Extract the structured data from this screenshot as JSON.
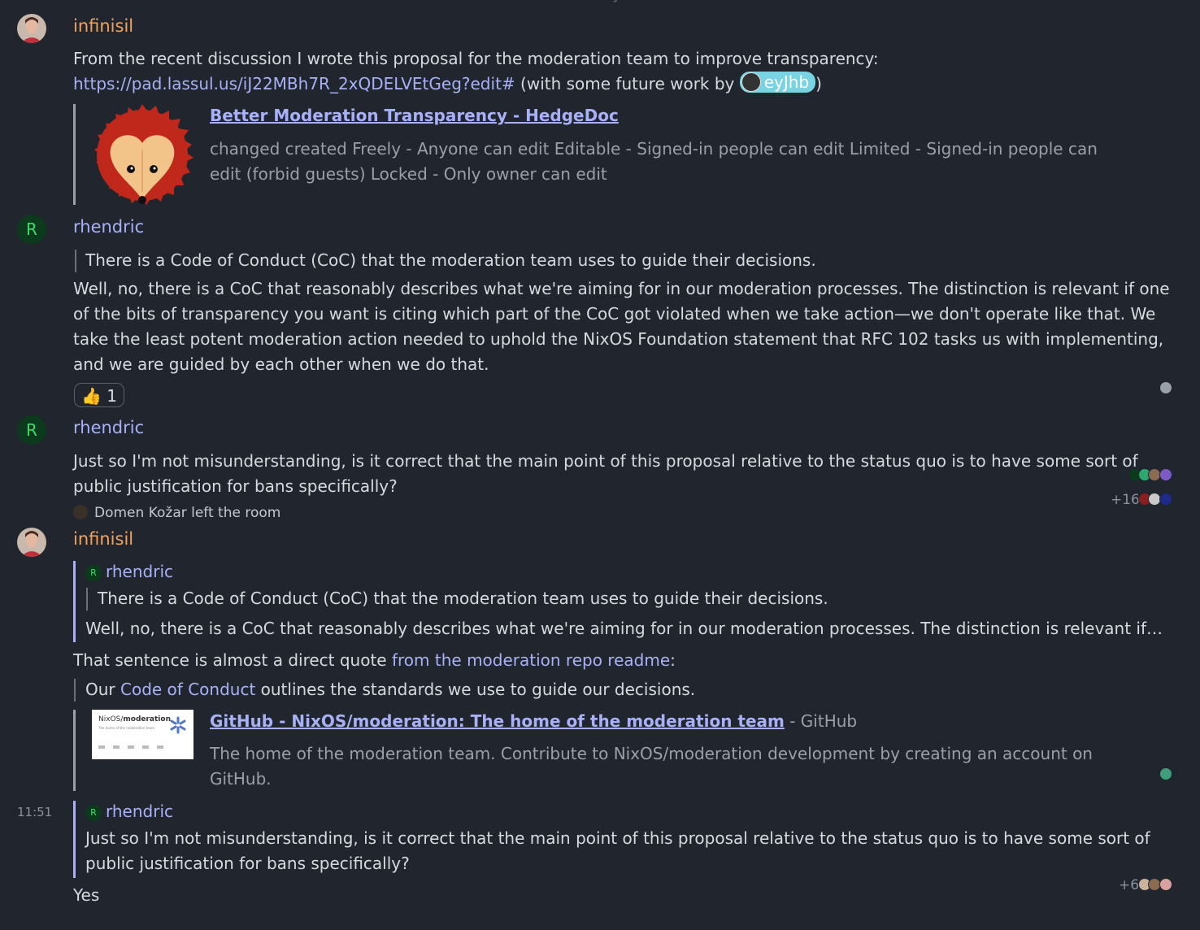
{
  "date_separator": "Today",
  "messages": [
    {
      "sender": "infinisil",
      "line1": "From the recent discussion I wrote this proposal for the moderation team to improve transparency:",
      "link": "https://pad.lassul.us/iJ22MBh7R_2xQDELVEtGeg?edit#",
      "after_link": " (with some future work by ",
      "mention": "eyJhb",
      "after_mention": ")",
      "preview": {
        "title": "Better Moderation Transparency - HedgeDoc",
        "desc_line1": "changed created Freely - Anyone can edit Editable - Signed-in people can edit Limited - Signed-in people can",
        "desc_line2": "edit (forbid guests) Locked - Only owner can edit"
      }
    },
    {
      "sender": "rhendric",
      "avatar_letter": "R",
      "quote": "There is a Code of Conduct (CoC) that the moderation team uses to guide their decisions.",
      "lines": [
        "Well, no, there is a CoC that reasonably describes what we're aiming for in our moderation processes. The distinction is relevant if one",
        "of the bits of transparency you want is citing which part of the CoC got violated when we take action—we don't operate like that. We",
        "take the least potent moderation action needed to uphold the NixOS Foundation statement that RFC 102 tasks us with implementing,",
        "and we are guided by each other when we do that."
      ],
      "reaction": {
        "emoji": "👍",
        "count": "1"
      }
    },
    {
      "sender": "rhendric",
      "avatar_letter": "R",
      "lines": [
        "Just so I'm not misunderstanding, is it correct that the main point of this proposal relative to the status quo is to have some sort of",
        "public justification for bans specifically?"
      ],
      "receipts_extra": "+16"
    },
    {
      "event": "Domen Kožar left the room"
    },
    {
      "sender": "infinisil",
      "reply": {
        "sender": "rhendric",
        "avatar_letter": "R",
        "quote": "There is a Code of Conduct (CoC) that the moderation team uses to guide their decisions.",
        "text": "Well, no, there is a CoC that reasonably describes what we're aiming for in our moderation processes. The distinction is relevant if…"
      },
      "line_pre": "That sentence is almost a direct quote ",
      "line_link": "from the moderation repo readme",
      "line_post": ":",
      "quote_pre": "Our ",
      "quote_link": "Code of Conduct",
      "quote_post": " outlines the standards we use to guide our decisions.",
      "preview": {
        "thumb_title_a": "NixOS/",
        "thumb_title_b": "moderation",
        "thumb_sub": "The home of the moderation team",
        "title": "GitHub - NixOS/moderation: The home of the moderation team",
        "site": " - GitHub",
        "desc_line1": "The home of the moderation team. Contribute to NixOS/moderation development by creating an account on",
        "desc_line2": "GitHub."
      }
    },
    {
      "timestamp": "11:51",
      "reply": {
        "sender": "rhendric",
        "avatar_letter": "R",
        "lines": [
          "Just so I'm not misunderstanding, is it correct that the main point of this proposal relative to the status quo is to have some sort of",
          "public justification for bans specifically?"
        ]
      },
      "text": "Yes",
      "receipts_extra": "+6"
    }
  ],
  "colors": {
    "background": "#21262e",
    "accent_link": "#a8b0f8",
    "infinisil": "#f0a35e",
    "avatar_green": "#3ddc6a"
  }
}
